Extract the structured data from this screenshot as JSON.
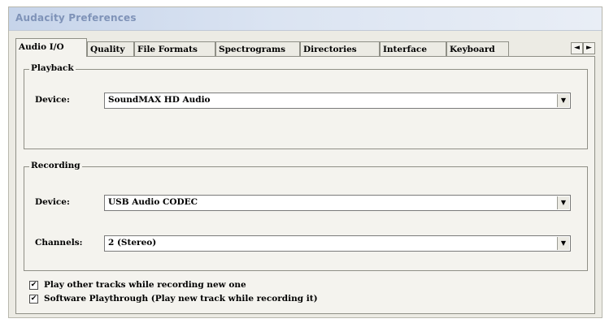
{
  "window": {
    "title": "Audacity Preferences"
  },
  "tabs": [
    {
      "label": "Audio I/O",
      "active": true
    },
    {
      "label": "Quality"
    },
    {
      "label": "File Formats"
    },
    {
      "label": "Spectrograms"
    },
    {
      "label": "Directories"
    },
    {
      "label": "Interface"
    },
    {
      "label": "Keyboard"
    }
  ],
  "tab_scroll": {
    "left": "◄",
    "right": "►"
  },
  "playback": {
    "group_label": "Playback",
    "device_label": "Device:",
    "device_value": "SoundMAX HD Audio"
  },
  "recording": {
    "group_label": "Recording",
    "device_label": "Device:",
    "device_value": "USB Audio CODEC",
    "channels_label": "Channels:",
    "channels_value": "2 (Stereo)"
  },
  "options": [
    {
      "label": "Play other tracks while recording new one",
      "checked": true
    },
    {
      "label": "Software Playthrough (Play new track while recording it)",
      "checked": true
    }
  ],
  "glyphs": {
    "dropdown_arrow": "▼",
    "check": "✔"
  }
}
